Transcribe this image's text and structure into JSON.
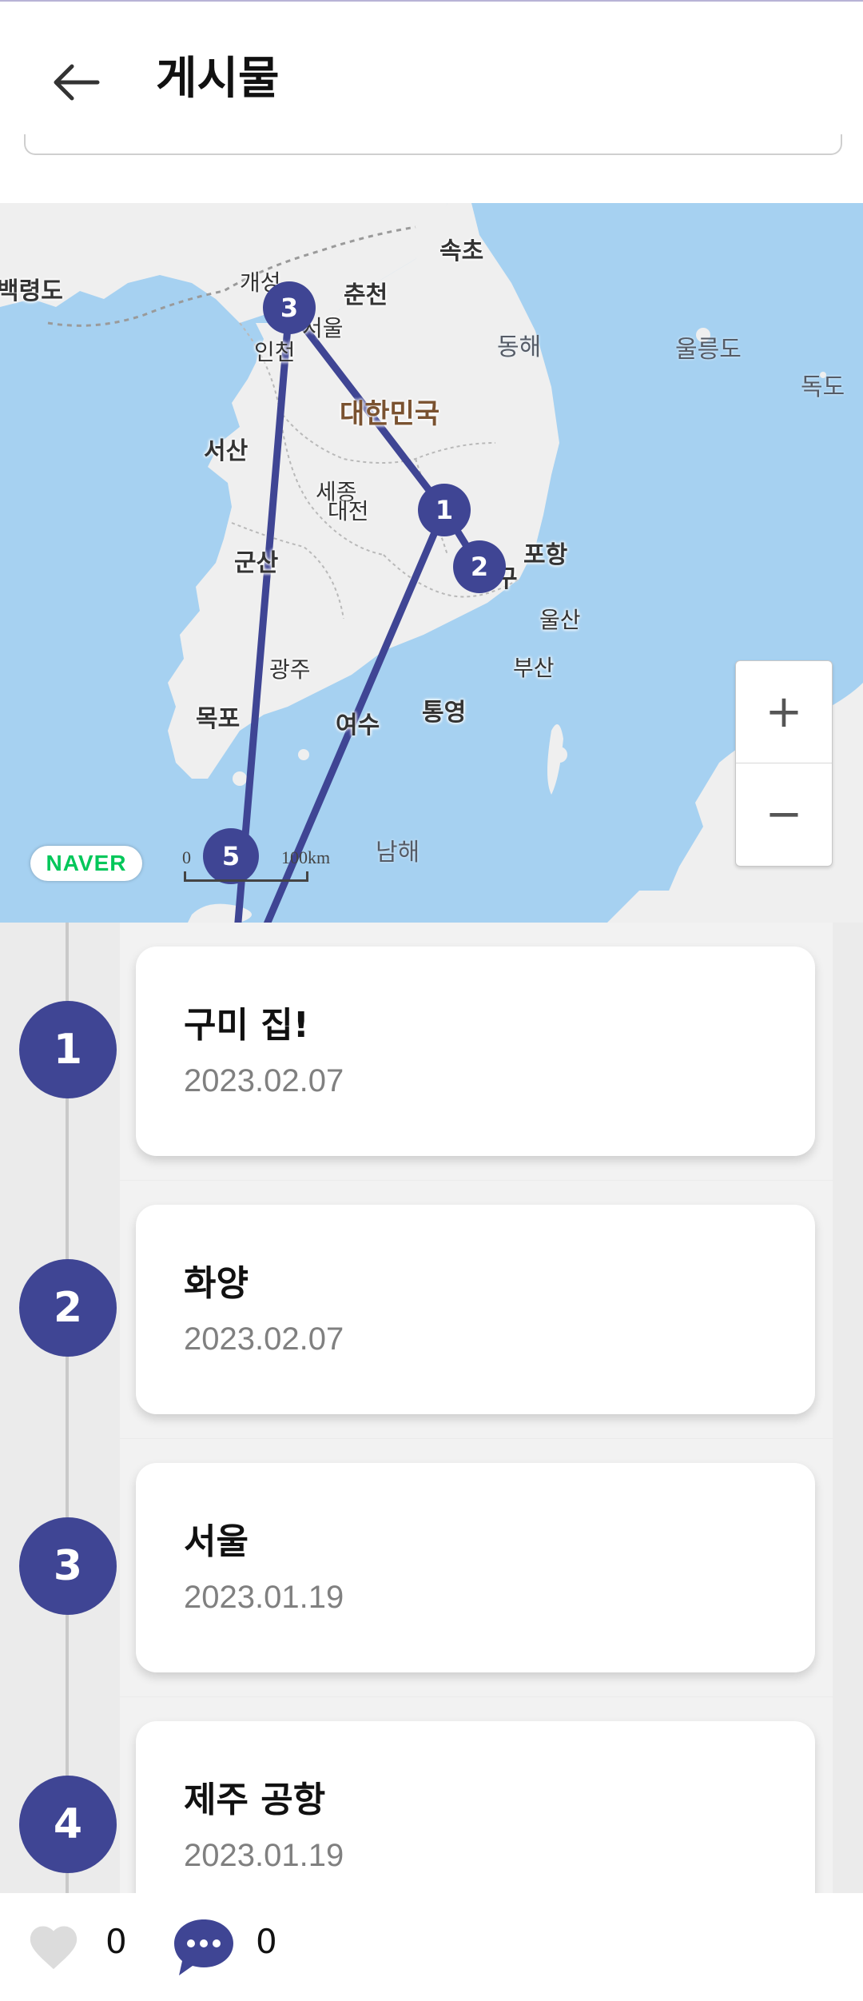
{
  "header": {
    "back_icon": "arrow-left-icon",
    "title": "게시물"
  },
  "map": {
    "labels": {
      "baengnyeongdo": "백령도",
      "gaeseong": "개성",
      "chuncheon": "춘천",
      "sokcho": "속초",
      "seoul": "서울",
      "incheon": "인천",
      "donghae": "동해",
      "ulleungdo": "울릉도",
      "dokdo": "독도",
      "korea": "대한민국",
      "seosan": "서산",
      "sejong": "세종",
      "daejeon": "대전",
      "gunsan": "군산",
      "pohang": "포항",
      "daegu": "구",
      "ulsan": "울산",
      "gwangju": "광주",
      "busan": "부산",
      "mokpo": "목포",
      "yeosu": "여수",
      "tongyeong": "통영",
      "namhae": "남해"
    },
    "markers": [
      "1",
      "2",
      "3",
      "5"
    ],
    "zoom_in": "+",
    "zoom_out": "−",
    "logo": "NAVER",
    "scale_min": "0",
    "scale_max": "100km",
    "route_color": "#3f4594"
  },
  "stops": [
    {
      "number": "1",
      "title": "구미 집!",
      "date": "2023.02.07"
    },
    {
      "number": "2",
      "title": "화양",
      "date": "2023.02.07"
    },
    {
      "number": "3",
      "title": "서울",
      "date": "2023.01.19"
    },
    {
      "number": "4",
      "title": "제주 공항",
      "date": "2023.01.19"
    }
  ],
  "bottom_bar": {
    "like_icon": "heart-icon",
    "like_count": "0",
    "comment_icon": "comment-bubble-icon",
    "comment_count": "0"
  },
  "colors": {
    "accent": "#3f4594",
    "sea": "#a6d1f1",
    "land": "#efefef",
    "list_background": "#ebebeb"
  }
}
